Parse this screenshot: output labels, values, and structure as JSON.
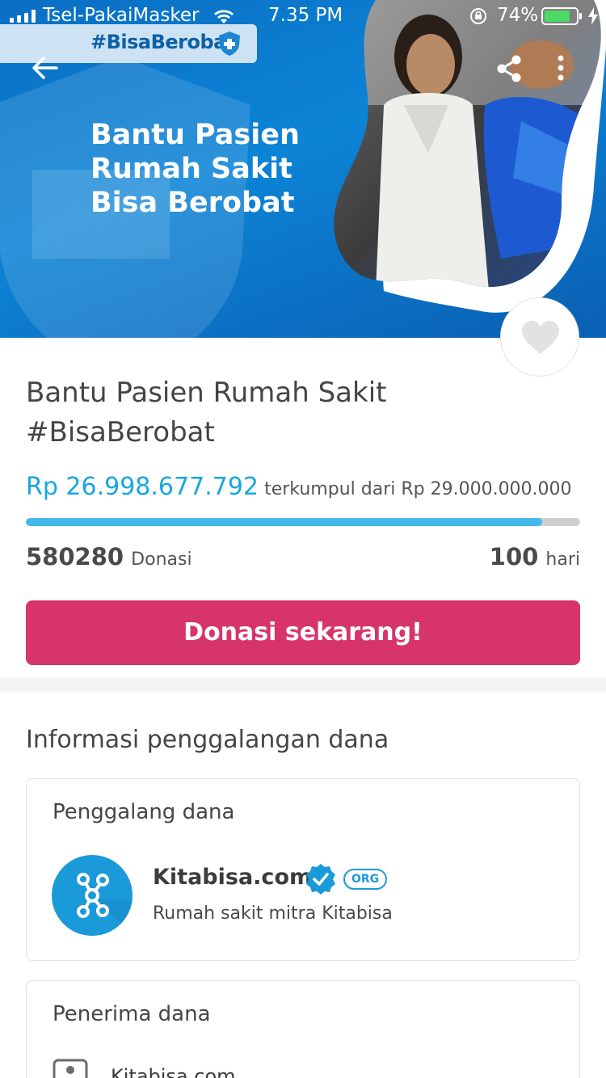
{
  "status_bar": {
    "carrier": "Tsel-PakaiMasker",
    "time": "7.35 PM",
    "battery": "74%"
  },
  "hero": {
    "tag": "#BisaBerobat",
    "headline": [
      "Bantu Pasien",
      "Rumah Sakit",
      "Bisa Berobat"
    ]
  },
  "campaign": {
    "title": "Bantu Pasien Rumah Sakit #BisaBerobat",
    "amount_collected": "Rp 26.998.677.792",
    "amount_suffix": "terkumpul dari Rp 29.000.000.000",
    "progress_fraction": 0.931,
    "donation_count": "580280",
    "donation_label": "Donasi",
    "days_left": "100",
    "days_label": "hari",
    "donate_button": "Donasi sekarang!"
  },
  "info": {
    "section_title": "Informasi penggalangan dana",
    "fundraiser": {
      "heading": "Penggalang dana",
      "name": "Kitabisa.com",
      "badge": "ORG",
      "description": "Rumah sakit mitra Kitabisa"
    },
    "recipient": {
      "heading": "Penerima dana",
      "name": "Kitabisa.com"
    }
  },
  "colors": {
    "accent": "#16a7e1",
    "donate_button": "#d7346b",
    "hero_blue": "#0c84d6"
  },
  "icons": [
    "back-arrow-icon",
    "share-icon",
    "more-vertical-icon",
    "heart-icon",
    "verified-icon",
    "kitabisa-logo-icon",
    "id-card-icon",
    "wifi-icon",
    "signal-icon",
    "battery-icon",
    "lock-rotation-icon"
  ]
}
